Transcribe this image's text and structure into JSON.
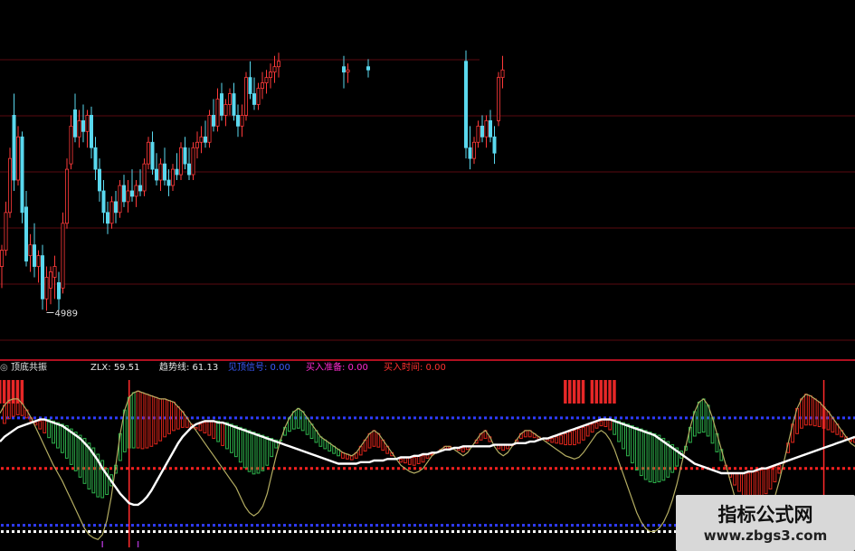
{
  "chart_data": [
    {
      "type": "candlestick",
      "title": "",
      "y_range": [
        4950,
        5260
      ],
      "low_label": "4989",
      "colors": {
        "up": "#ff3a3a",
        "down": "#5ad8ee"
      },
      "candles": [
        {
          "o": 5030,
          "h": 5050,
          "l": 5010,
          "c": 5045
        },
        {
          "o": 5045,
          "h": 5090,
          "l": 5040,
          "c": 5080
        },
        {
          "o": 5080,
          "h": 5140,
          "l": 5075,
          "c": 5130
        },
        {
          "o": 5170,
          "h": 5190,
          "l": 5100,
          "c": 5110
        },
        {
          "o": 5110,
          "h": 5160,
          "l": 5105,
          "c": 5150
        },
        {
          "o": 5150,
          "h": 5155,
          "l": 5070,
          "c": 5080
        },
        {
          "o": 5085,
          "h": 5100,
          "l": 5030,
          "c": 5035
        },
        {
          "o": 5040,
          "h": 5060,
          "l": 5025,
          "c": 5050
        },
        {
          "o": 5050,
          "h": 5070,
          "l": 5020,
          "c": 5030
        },
        {
          "o": 5030,
          "h": 5045,
          "l": 5015,
          "c": 5040
        },
        {
          "o": 5040,
          "h": 5050,
          "l": 4990,
          "c": 5000
        },
        {
          "o": 5000,
          "h": 5030,
          "l": 4989,
          "c": 5020
        },
        {
          "o": 5010,
          "h": 5030,
          "l": 4995,
          "c": 5025
        },
        {
          "o": 5020,
          "h": 5040,
          "l": 5000,
          "c": 5030
        },
        {
          "o": 5015,
          "h": 5025,
          "l": 4990,
          "c": 5000
        },
        {
          "o": 5010,
          "h": 5080,
          "l": 5005,
          "c": 5070
        },
        {
          "o": 5070,
          "h": 5130,
          "l": 5065,
          "c": 5120
        },
        {
          "o": 5125,
          "h": 5170,
          "l": 5120,
          "c": 5160
        },
        {
          "o": 5175,
          "h": 5190,
          "l": 5145,
          "c": 5150
        },
        {
          "o": 5150,
          "h": 5175,
          "l": 5140,
          "c": 5165
        },
        {
          "o": 5165,
          "h": 5180,
          "l": 5145,
          "c": 5155
        },
        {
          "o": 5155,
          "h": 5175,
          "l": 5140,
          "c": 5170
        },
        {
          "o": 5170,
          "h": 5178,
          "l": 5130,
          "c": 5140
        },
        {
          "o": 5140,
          "h": 5150,
          "l": 5110,
          "c": 5120
        },
        {
          "o": 5120,
          "h": 5130,
          "l": 5090,
          "c": 5100
        },
        {
          "o": 5100,
          "h": 5110,
          "l": 5070,
          "c": 5080
        },
        {
          "o": 5080,
          "h": 5090,
          "l": 5060,
          "c": 5070
        },
        {
          "o": 5070,
          "h": 5095,
          "l": 5065,
          "c": 5090
        },
        {
          "o": 5090,
          "h": 5100,
          "l": 5070,
          "c": 5080
        },
        {
          "o": 5080,
          "h": 5110,
          "l": 5075,
          "c": 5105
        },
        {
          "o": 5105,
          "h": 5115,
          "l": 5085,
          "c": 5090
        },
        {
          "o": 5090,
          "h": 5110,
          "l": 5080,
          "c": 5100
        },
        {
          "o": 5100,
          "h": 5120,
          "l": 5090,
          "c": 5095
        },
        {
          "o": 5095,
          "h": 5110,
          "l": 5085,
          "c": 5105
        },
        {
          "o": 5105,
          "h": 5120,
          "l": 5095,
          "c": 5100
        },
        {
          "o": 5100,
          "h": 5130,
          "l": 5095,
          "c": 5125
        },
        {
          "o": 5125,
          "h": 5150,
          "l": 5120,
          "c": 5145
        },
        {
          "o": 5145,
          "h": 5155,
          "l": 5115,
          "c": 5120
        },
        {
          "o": 5120,
          "h": 5135,
          "l": 5105,
          "c": 5110
        },
        {
          "o": 5110,
          "h": 5130,
          "l": 5100,
          "c": 5125
        },
        {
          "o": 5125,
          "h": 5140,
          "l": 5105,
          "c": 5110
        },
        {
          "o": 5110,
          "h": 5120,
          "l": 5095,
          "c": 5105
        },
        {
          "o": 5105,
          "h": 5125,
          "l": 5100,
          "c": 5120
        },
        {
          "o": 5120,
          "h": 5135,
          "l": 5110,
          "c": 5115
        },
        {
          "o": 5115,
          "h": 5145,
          "l": 5110,
          "c": 5140
        },
        {
          "o": 5140,
          "h": 5150,
          "l": 5120,
          "c": 5125
        },
        {
          "o": 5125,
          "h": 5140,
          "l": 5110,
          "c": 5115
        },
        {
          "o": 5115,
          "h": 5145,
          "l": 5110,
          "c": 5140
        },
        {
          "o": 5140,
          "h": 5155,
          "l": 5130,
          "c": 5145
        },
        {
          "o": 5145,
          "h": 5160,
          "l": 5135,
          "c": 5150
        },
        {
          "o": 5150,
          "h": 5165,
          "l": 5140,
          "c": 5145
        },
        {
          "o": 5145,
          "h": 5175,
          "l": 5140,
          "c": 5170
        },
        {
          "o": 5170,
          "h": 5185,
          "l": 5155,
          "c": 5160
        },
        {
          "o": 5160,
          "h": 5195,
          "l": 5155,
          "c": 5185
        },
        {
          "o": 5190,
          "h": 5200,
          "l": 5165,
          "c": 5170
        },
        {
          "o": 5170,
          "h": 5185,
          "l": 5160,
          "c": 5180
        },
        {
          "o": 5180,
          "h": 5195,
          "l": 5170,
          "c": 5190
        },
        {
          "o": 5190,
          "h": 5200,
          "l": 5165,
          "c": 5170
        },
        {
          "o": 5170,
          "h": 5180,
          "l": 5150,
          "c": 5160
        },
        {
          "o": 5160,
          "h": 5180,
          "l": 5150,
          "c": 5170
        },
        {
          "o": 5170,
          "h": 5210,
          "l": 5165,
          "c": 5205
        },
        {
          "o": 5205,
          "h": 5220,
          "l": 5185,
          "c": 5190
        },
        {
          "o": 5190,
          "h": 5205,
          "l": 5175,
          "c": 5180
        },
        {
          "o": 5180,
          "h": 5200,
          "l": 5175,
          "c": 5195
        },
        {
          "o": 5195,
          "h": 5210,
          "l": 5185,
          "c": 5200
        },
        {
          "o": 5200,
          "h": 5212,
          "l": 5190,
          "c": 5205
        },
        {
          "o": 5205,
          "h": 5218,
          "l": 5195,
          "c": 5210
        },
        {
          "o": 5210,
          "h": 5225,
          "l": 5200,
          "c": 5215
        },
        {
          "o": 5215,
          "h": 5228,
          "l": 5205,
          "c": 5220
        },
        null,
        null,
        null,
        null,
        null,
        null,
        null,
        null,
        null,
        null,
        null,
        null,
        null,
        null,
        null,
        {
          "o": 5215,
          "h": 5225,
          "l": 5195,
          "c": 5210
        },
        {
          "o": 5210,
          "h": 5218,
          "l": 5200,
          "c": 5212
        },
        null,
        null,
        null,
        null,
        {
          "o": 5215,
          "h": 5222,
          "l": 5205,
          "c": 5212
        },
        null,
        null,
        null,
        null,
        null,
        null,
        null,
        null,
        null,
        null,
        null,
        null,
        null,
        null,
        null,
        null,
        null,
        null,
        null,
        null,
        null,
        null,
        null,
        {
          "o": 5220,
          "h": 5230,
          "l": 5130,
          "c": 5140
        },
        {
          "o": 5140,
          "h": 5160,
          "l": 5120,
          "c": 5130
        },
        {
          "o": 5130,
          "h": 5150,
          "l": 5125,
          "c": 5145
        },
        {
          "o": 5145,
          "h": 5165,
          "l": 5140,
          "c": 5160
        },
        {
          "o": 5160,
          "h": 5170,
          "l": 5145,
          "c": 5150
        },
        {
          "o": 5150,
          "h": 5170,
          "l": 5140,
          "c": 5165
        },
        {
          "o": 5165,
          "h": 5175,
          "l": 5145,
          "c": 5150
        },
        {
          "o": 5150,
          "h": 5160,
          "l": 5125,
          "c": 5135
        },
        {
          "o": 5165,
          "h": 5210,
          "l": 5160,
          "c": 5205
        },
        {
          "o": 5205,
          "h": 5225,
          "l": 5195,
          "c": 5212
        }
      ]
    },
    {
      "type": "line",
      "title": "顶底共振",
      "y_range": [
        -2,
        104
      ],
      "colors": {
        "zlx": "#ffffff",
        "trend": "#b4ad62",
        "bar_up": "#e0261b",
        "bar_down": "#2fb54d",
        "upper_level": "#2f3cff",
        "mid_level": "#ff2020",
        "lower_level": "#2f3cff",
        "bottom_level": "#ffffff",
        "signal": "#ff2b2b",
        "accent": "#a030c0"
      },
      "levels": {
        "upper": 80,
        "mid": 48,
        "lower": 12,
        "bottom": 8
      },
      "indicators": [
        {
          "name": "ZLX",
          "value": "59.51",
          "color": "#e8e8e8"
        },
        {
          "name": "趋势线",
          "value": "61.13",
          "color": "#e8e8e8"
        },
        {
          "name": "见顶信号",
          "value": "0.00",
          "color": "#3a5cff"
        },
        {
          "name": "买入准备",
          "value": "0.00",
          "color": "#ff2bd0"
        },
        {
          "name": "买入时间",
          "value": "0.00",
          "color": "#ff3030"
        }
      ],
      "zlx": [
        65,
        68,
        70,
        72,
        74,
        75,
        76,
        77,
        78,
        79,
        79,
        78,
        77,
        76,
        75,
        73,
        71,
        69,
        67,
        64,
        61,
        57,
        53,
        48,
        44,
        40,
        36,
        32,
        29,
        26,
        25,
        25,
        27,
        30,
        34,
        39,
        44,
        49,
        54,
        59,
        64,
        68,
        71,
        74,
        76,
        77,
        78,
        78,
        78,
        77,
        77,
        76,
        75,
        74,
        73,
        72,
        71,
        70,
        69,
        68,
        67,
        66,
        65,
        64,
        63,
        62,
        61,
        60,
        59,
        58,
        57,
        56,
        55,
        54,
        53,
        52,
        51,
        51,
        51,
        51,
        51,
        52,
        52,
        52,
        53,
        53,
        53,
        54,
        54,
        54,
        55,
        55,
        55,
        56,
        56,
        57,
        57,
        58,
        58,
        59,
        60,
        60,
        61,
        61,
        62,
        62,
        62,
        62,
        62,
        62,
        62,
        63,
        63,
        63,
        63,
        63,
        64,
        64,
        64,
        65,
        65,
        66,
        67,
        67,
        68,
        69,
        70,
        71,
        72,
        73,
        74,
        75,
        76,
        77,
        78,
        79,
        79,
        79,
        78,
        77,
        76,
        75,
        74,
        73,
        72,
        71,
        70,
        69,
        67,
        65,
        63,
        61,
        59,
        57,
        55,
        53,
        51,
        50,
        49,
        48,
        47,
        46,
        45,
        45,
        45,
        45,
        45,
        45,
        46,
        46,
        47,
        48,
        48,
        49,
        50,
        51,
        52,
        53,
        54,
        55,
        56,
        57,
        58,
        59,
        60,
        61,
        62,
        63,
        64,
        65,
        66,
        67,
        68
      ],
      "trend": [
        83,
        88,
        91,
        92,
        92,
        89,
        85,
        80,
        74,
        68,
        62,
        56,
        50,
        45,
        40,
        34,
        28,
        22,
        16,
        10,
        6,
        4,
        3,
        6,
        15,
        30,
        50,
        70,
        85,
        93,
        96,
        97,
        96,
        95,
        94,
        93,
        92,
        92,
        91,
        90,
        87,
        84,
        80,
        76,
        72,
        68,
        64,
        60,
        56,
        52,
        48,
        44,
        40,
        36,
        30,
        24,
        20,
        18,
        20,
        24,
        32,
        44,
        56,
        66,
        74,
        80,
        84,
        86,
        84,
        80,
        76,
        72,
        68,
        66,
        64,
        62,
        60,
        58,
        57,
        56,
        58,
        62,
        66,
        70,
        72,
        70,
        66,
        62,
        58,
        54,
        50,
        48,
        46,
        45,
        46,
        48,
        52,
        56,
        58,
        60,
        62,
        62,
        60,
        58,
        56,
        58,
        62,
        66,
        70,
        72,
        68,
        62,
        58,
        56,
        58,
        62,
        66,
        70,
        72,
        72,
        70,
        68,
        66,
        64,
        62,
        60,
        58,
        56,
        55,
        54,
        55,
        58,
        62,
        66,
        70,
        72,
        70,
        66,
        60,
        52,
        44,
        36,
        28,
        20,
        14,
        10,
        8,
        8,
        10,
        14,
        20,
        28,
        38,
        50,
        62,
        74,
        84,
        90,
        92,
        88,
        80,
        70,
        60,
        50,
        40,
        30,
        22,
        16,
        12,
        10,
        10,
        12,
        16,
        22,
        30,
        40,
        52,
        64,
        76,
        86,
        92,
        95,
        94,
        92,
        90,
        87,
        84,
        80,
        76,
        72,
        68,
        64,
        62,
        60,
        58
      ]
    }
  ],
  "watermark": {
    "title": "指标公式网",
    "url": "www.zbgs3.com"
  }
}
